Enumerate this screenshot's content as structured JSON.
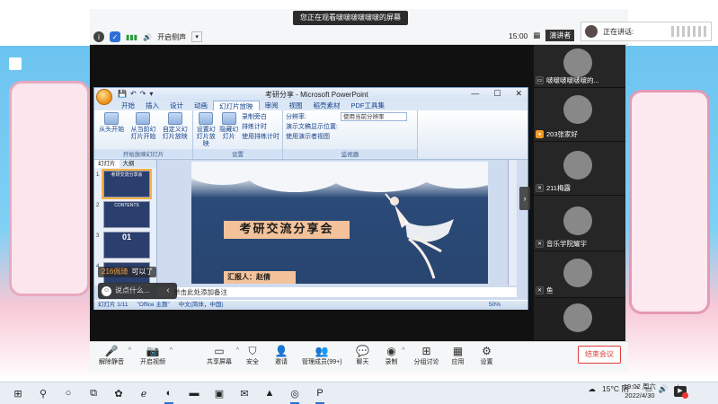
{
  "meeting": {
    "sharing_banner": "您正在观看啵啵啵啵啵啵的屏幕",
    "audio_label": "开启侧声",
    "time": "15:00",
    "speaker_view": "演讲者",
    "talking_label": "正在讲话:"
  },
  "ppt": {
    "window_title": "考研分享 - Microsoft PowerPoint",
    "tabs": [
      "开始",
      "插入",
      "设计",
      "动画",
      "幻灯片放映",
      "审阅",
      "视图",
      "稻壳素材",
      "PDF工具集"
    ],
    "active_tab": "幻灯片放映",
    "ribbon": {
      "from_start": "从头开始",
      "from_current": "从当前幻灯片开始",
      "custom_show": "自定义幻灯片放映",
      "group_start": "开始放映幻灯片",
      "setup_show": "设置幻灯片放映",
      "hide_slide": "隐藏幻灯片",
      "record_narration": "录制旁白",
      "rehearse": "排练计时",
      "use_timings": "使用排练计时",
      "group_setup": "设置",
      "resolution": "分辨率:",
      "resolution_value": "使用当前分辨率",
      "show_on": "演示文稿显示位置:",
      "presenter_view": "使用演示者视图",
      "group_monitors": "监视器"
    },
    "pane_tabs": [
      "幻灯片",
      "大纲"
    ],
    "thumbs": [
      {
        "num": "1",
        "text": "考研交流分享会"
      },
      {
        "num": "2",
        "text": "CONTENTS"
      },
      {
        "num": "3",
        "text": "01"
      },
      {
        "num": "4",
        "text": ""
      }
    ],
    "slide": {
      "title": "考研交流分享会",
      "presenter": "汇报人：赵倩"
    },
    "notes_placeholder": "单击此处添加备注",
    "status": {
      "slide_info": "幻灯片 1/11",
      "theme": "\"Office 主题\"",
      "language": "中文(简体，中国)",
      "zoom": "50%"
    }
  },
  "chat": {
    "sender": "216佩琦",
    "message": "可以了",
    "input_placeholder": "说点什么..."
  },
  "participants": [
    {
      "name": "啵啵啵啵啵啵的..."
    },
    {
      "name": "203张家好"
    },
    {
      "name": "211梅露"
    },
    {
      "name": "音乐学院耀宇"
    },
    {
      "name": ""
    },
    {
      "name": "鱼"
    },
    {
      "name": ""
    }
  ],
  "toolbar": {
    "unmute": "解除静音",
    "start_video": "开启视频",
    "share_screen": "共享屏幕",
    "security": "安全",
    "invite": "邀请",
    "participants": "管理成员(99+)",
    "chat": "聊天",
    "record": "录制",
    "breakout": "分组讨论",
    "apps": "应用",
    "settings": "设置",
    "leave": "结束会议"
  },
  "taskbar": {
    "weather": "15°C 阴",
    "ime": "中",
    "time": "19:02 周六",
    "date": "2022/4/30",
    "notifications": "1"
  }
}
